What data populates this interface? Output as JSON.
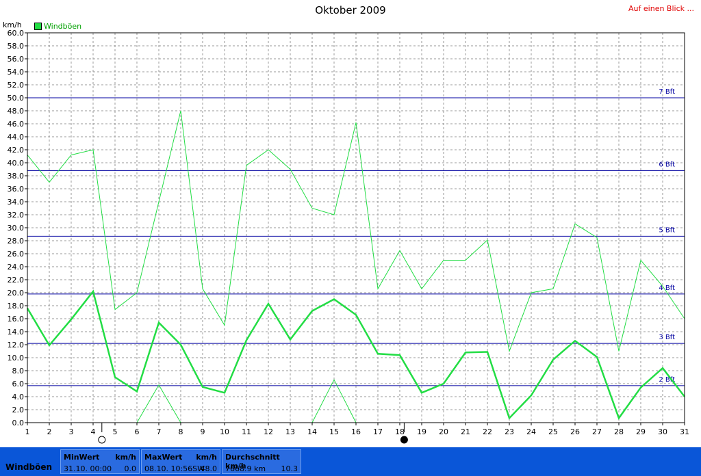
{
  "header": {
    "title": "Oktober 2009",
    "overview_link": "Auf einen Blick ...",
    "unit": "km/h"
  },
  "chart_data": {
    "type": "line",
    "title": "Oktober 2009",
    "ylabel": "km/h",
    "xlim": [
      1,
      31
    ],
    "ylim": [
      0,
      60
    ],
    "grid": true,
    "legend_position": "top-left",
    "x": [
      1,
      2,
      3,
      4,
      5,
      6,
      7,
      8,
      9,
      10,
      11,
      12,
      13,
      14,
      15,
      16,
      17,
      18,
      19,
      20,
      21,
      22,
      23,
      24,
      25,
      26,
      27,
      28,
      29,
      30,
      31
    ],
    "x_tick_labels": [
      "1",
      "2",
      "3",
      "4",
      "5",
      "6",
      "7",
      "8",
      "9",
      "10",
      "11",
      "12",
      "13",
      "14",
      "15",
      "16",
      "17",
      "18",
      "19",
      "20",
      "21",
      "22",
      "23",
      "24",
      "25",
      "26",
      "27",
      "28",
      "29",
      "30",
      "31"
    ],
    "y_tick_labels": [
      "0.0",
      "2.0",
      "4.0",
      "6.0",
      "8.0",
      "10.0",
      "12.0",
      "14.0",
      "16.0",
      "18.0",
      "20.0",
      "22.0",
      "24.0",
      "26.0",
      "28.0",
      "30.0",
      "32.0",
      "34.0",
      "36.0",
      "38.0",
      "40.0",
      "42.0",
      "44.0",
      "46.0",
      "48.0",
      "50.0",
      "52.0",
      "54.0",
      "56.0",
      "58.0",
      "60.0"
    ],
    "y_ticks": [
      0,
      2,
      4,
      6,
      8,
      10,
      12,
      14,
      16,
      18,
      20,
      22,
      24,
      26,
      28,
      30,
      32,
      34,
      36,
      38,
      40,
      42,
      44,
      46,
      48,
      50,
      52,
      54,
      56,
      58,
      60
    ],
    "series": [
      {
        "name": "Windböen",
        "role": "average",
        "color": "#22dd44",
        "values": [
          17.6,
          11.9,
          15.9,
          20.2,
          7.0,
          4.8,
          15.4,
          12.0,
          5.5,
          4.6,
          12.7,
          18.3,
          12.8,
          17.2,
          19.0,
          16.6,
          10.6,
          10.4,
          4.6,
          6.0,
          10.8,
          10.9,
          0.7,
          4.2,
          9.7,
          12.6,
          10.1,
          0.7,
          5.4,
          8.4,
          4.0
        ]
      },
      {
        "name": "",
        "role": "max",
        "color": "#22dd44",
        "values": [
          41.2,
          37.0,
          41.2,
          42.0,
          17.4,
          20.0,
          34.0,
          48.0,
          20.6,
          15.0,
          39.6,
          42.0,
          39.0,
          33.0,
          32.0,
          46.2,
          20.6,
          26.5,
          20.6,
          25.0,
          25.0,
          28.1,
          11.0,
          20.0,
          20.6,
          30.6,
          28.5,
          11.0,
          25.0,
          21.0,
          16.0
        ]
      },
      {
        "name": "",
        "role": "min",
        "color": "#22dd44",
        "values": [
          null,
          null,
          null,
          null,
          null,
          0.0,
          5.8,
          0.0,
          null,
          null,
          null,
          null,
          null,
          0.0,
          6.6,
          0.0,
          null,
          null,
          null,
          null,
          null,
          null,
          null,
          null,
          null,
          null,
          null,
          null,
          null,
          null,
          null
        ]
      }
    ],
    "reference_lines": [
      {
        "label": "2 Bft",
        "value": 5.7
      },
      {
        "label": "3 Bft",
        "value": 12.2
      },
      {
        "label": "4 Bft",
        "value": 19.8
      },
      {
        "label": "5 Bft",
        "value": 28.7
      },
      {
        "label": "6 Bft",
        "value": 38.8
      },
      {
        "label": "7 Bft",
        "value": 50.0
      }
    ],
    "moon_markers": [
      {
        "day": 4.4,
        "phase": "full-moon"
      },
      {
        "day": 18.2,
        "phase": "new-moon"
      }
    ]
  },
  "footer": {
    "series_name": "Windböen",
    "min": {
      "label": "MinWert",
      "unit": "km/h",
      "date": "31.10.  00:00",
      "value": "0.0"
    },
    "max": {
      "label": "MaxWert",
      "unit": "km/h",
      "date": "08.10.  10:56SW",
      "value": "48.0"
    },
    "avg": {
      "label": "Durchschnitt km/h",
      "distance": "7668.9 km",
      "value": "10.3"
    },
    "colors": {
      "bar": "#0a56d8",
      "box": "#2a6be0"
    }
  }
}
